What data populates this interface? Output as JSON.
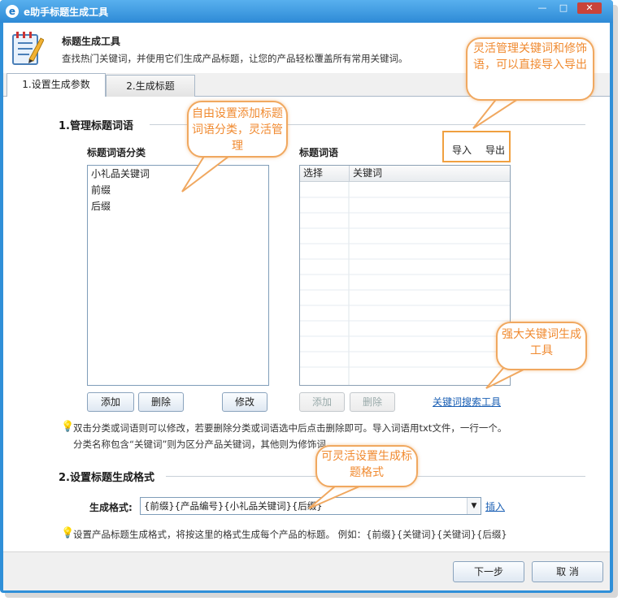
{
  "window": {
    "title": "e助手标题生成工具",
    "controls": {
      "minimize": "—",
      "maximize": "□",
      "close": "✕"
    }
  },
  "header": {
    "title": "标题生成工具",
    "subtitle": "查找热门关键词，并使用它们生成产品标题，让您的产品轻松覆盖所有常用关键词。"
  },
  "tabs": [
    {
      "label": "1.设置生成参数"
    },
    {
      "label": "2.生成标题"
    }
  ],
  "section1": {
    "title": "1.管理标题词语",
    "categories_label": "标题词语分类",
    "categories": [
      "小礼品关键词",
      "前缀",
      "后缀"
    ],
    "words_label": "标题词语",
    "import_label": "导入",
    "export_label": "导出",
    "grid_columns": [
      "选择",
      "关键词"
    ],
    "left_buttons": {
      "add": "添加",
      "delete": "删除",
      "edit": "修改"
    },
    "right_buttons": {
      "add": "添加",
      "delete": "删除"
    },
    "keyword_search_link": "关键词搜索工具",
    "tip_line1": "双击分类或词语则可以修改，若要删除分类或词语选中后点击删除即可。导入词语用txt文件，一行一个。",
    "tip_line2": "分类名称包含“关键词”则为区分产品关键词，其他则为修饰词。"
  },
  "section2": {
    "title": "2.设置标题生成格式",
    "format_label": "生成格式:",
    "format_value": "{前缀}{产品编号}{小礼品关键词}{后缀}",
    "insert_link": "插入",
    "tip": "设置产品标题生成格式，将按这里的格式生成每个产品的标题。 例如：{前缀}{关键词}{关键词}{后缀}"
  },
  "footer": {
    "next_label": "下一步",
    "cancel_label": "取 消"
  },
  "callouts": {
    "c1": "自由设置添加标题词语分类，灵活管理",
    "c2": "灵活管理关键词和修饰语，可以直接导入导出",
    "c3": "强大关键词生成工具",
    "c4": "可灵活设置生成标题格式"
  },
  "colors": {
    "accent": "#2e8ad6",
    "callout": "#f08a30",
    "link": "#1a5fb4"
  }
}
